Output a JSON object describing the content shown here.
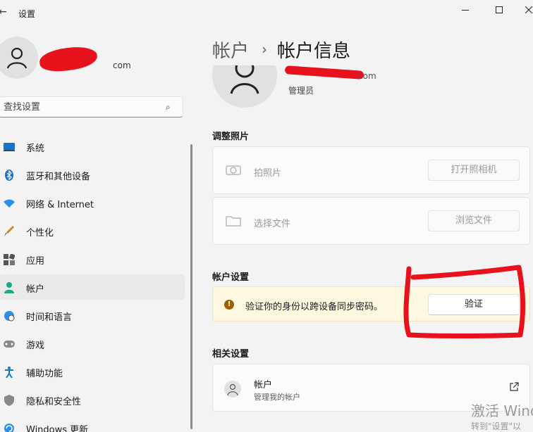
{
  "window": {
    "title": "设置"
  },
  "profile": {
    "email_suffix": "com"
  },
  "search": {
    "placeholder": "查找设置"
  },
  "nav": {
    "items": [
      {
        "label": "系统",
        "icon": "monitor-icon"
      },
      {
        "label": "蓝牙和其他设备",
        "icon": "bluetooth-icon"
      },
      {
        "label": "网络 & Internet",
        "icon": "wifi-icon"
      },
      {
        "label": "个性化",
        "icon": "brush-icon"
      },
      {
        "label": "应用",
        "icon": "apps-icon"
      },
      {
        "label": "帐户",
        "icon": "person-icon",
        "selected": true
      },
      {
        "label": "时间和语言",
        "icon": "globe-clock-icon"
      },
      {
        "label": "游戏",
        "icon": "gamepad-icon"
      },
      {
        "label": "辅助功能",
        "icon": "accessibility-icon"
      },
      {
        "label": "隐私和安全性",
        "icon": "shield-icon"
      },
      {
        "label": "Windows 更新",
        "icon": "update-icon"
      }
    ]
  },
  "breadcrumb": {
    "parent": "帐户",
    "separator": "›",
    "current": "帐户信息"
  },
  "account": {
    "email_suffix": "com",
    "role": "管理员"
  },
  "adjust_photo": {
    "title": "调整照片",
    "take_photo": {
      "label": "拍照片",
      "button": "打开照相机"
    },
    "choose_file": {
      "label": "选择文件",
      "button": "浏览文件"
    }
  },
  "account_settings": {
    "title": "帐户设置",
    "warning_text": "验证你的身份以跨设备同步密码。",
    "verify_button": "验证"
  },
  "related": {
    "title": "相关设置",
    "item_title": "帐户",
    "item_subtitle": "管理我的帐户"
  },
  "watermark": {
    "line1": "激活 Wind",
    "line2": "转到\"设置\"以"
  },
  "colors": {
    "accent": "#0067c0",
    "warning_bg": "#fff8e0",
    "annotation": "#e8121c"
  }
}
